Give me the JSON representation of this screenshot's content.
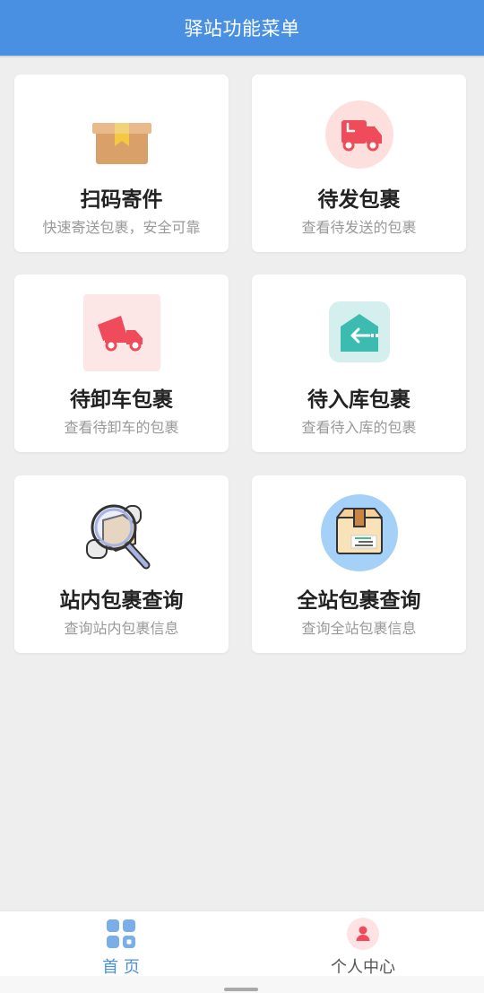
{
  "header": {
    "title": "驿站功能菜单"
  },
  "menu": [
    {
      "title": "扫码寄件",
      "subtitle": "快速寄送包裹，安全可靠",
      "icon": "package-box-icon"
    },
    {
      "title": "待发包裹",
      "subtitle": "查看待发送的包裹",
      "icon": "delivery-truck-icon"
    },
    {
      "title": "待卸车包裹",
      "subtitle": "查看待卸车的包裹",
      "icon": "dump-truck-icon"
    },
    {
      "title": "待入库包裹",
      "subtitle": "查看待入库的包裹",
      "icon": "warehouse-in-icon"
    },
    {
      "title": "站内包裹查询",
      "subtitle": "查询站内包裹信息",
      "icon": "magnifier-package-icon"
    },
    {
      "title": "全站包裹查询",
      "subtitle": "查询全站包裹信息",
      "icon": "package-document-icon"
    }
  ],
  "tabbar": {
    "home": {
      "label": "首 页",
      "icon": "grid-icon",
      "active": true
    },
    "profile": {
      "label": "个人中心",
      "icon": "user-icon",
      "active": false
    }
  },
  "colors": {
    "header": "#4a90e2",
    "active_tab": "#4a90e2",
    "accent_red": "#f04b5a"
  }
}
